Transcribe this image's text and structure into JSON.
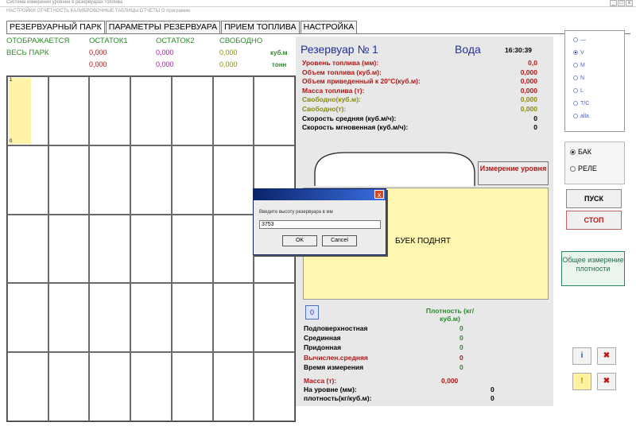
{
  "window": {
    "title": "Система измерения уровней в резервуарах топлива",
    "min_btn": "_",
    "max_btn": "□",
    "close_btn": "x"
  },
  "menu": {
    "items": "НАСТРОЙКИ   ОТЧЕТНОСТЬ   КАЛИБРОВОЧНЫЕ ТАБЛИЦЫ   ОТЧЕТЫ   О программе"
  },
  "tabs": [
    {
      "label": "РЕЗЕРВУАРНЫЙ ПАРК",
      "active": true
    },
    {
      "label": "ПАРАМЕТРЫ РЕЗЕРВУАРА",
      "active": false
    },
    {
      "label": "ПРИЕМ ТОПЛИВА",
      "active": false
    },
    {
      "label": "НАСТРОЙКА",
      "active": false
    }
  ],
  "summary": {
    "header_displayed": "ОТОБРАЖАЕТСЯ",
    "header_all_park": "ВЕСЬ ПАРК",
    "header_rest1": "ОСТАТОК1",
    "header_rest2": "ОСТАТОК2",
    "header_free": "СВОБОДНО",
    "rest1_m3": "0,000",
    "rest2_m3": "0,000",
    "free_m3": "0,000",
    "unit_m3": "куб.м",
    "rest1_t": "0,000",
    "rest2_t": "0,000",
    "free_t": "0,000",
    "unit_t": "тонн"
  },
  "grid": {
    "cols": 7,
    "rows": 5,
    "first_cell_top": "1",
    "first_cell_bottom": "0"
  },
  "tank": {
    "title": "Резервуар №",
    "number": "1",
    "product": "Вода",
    "time": "16:30:39",
    "params": [
      {
        "label": "Уровень топлива (мм):",
        "value": "0,0",
        "color": "#b01818"
      },
      {
        "label": "Объем топлива (куб.м):",
        "value": "0,000",
        "color": "#b01818"
      },
      {
        "label": "Объем приведенный к 20°С(куб.м):",
        "value": "0,000",
        "color": "#b01818"
      },
      {
        "label": "Масса топлива (т):",
        "value": "0,000",
        "color": "#b01818"
      },
      {
        "label": "Свободно(куб.м):",
        "value": "0,000",
        "color": "#8a8a10"
      },
      {
        "label": "Свободно(т):",
        "value": "0,000",
        "color": "#8a8a10"
      },
      {
        "label": "Скорость средняя (куб.м/ч):",
        "value": "0",
        "color": "#000000"
      },
      {
        "label": "Скорость мгновенная (куб.м/ч):",
        "value": "0",
        "color": "#000000"
      }
    ],
    "measure_button": "Измерение уровня",
    "float_status": "БУЕК ПОДНЯТ",
    "small_btn": "0",
    "density_header": "Плотность (кг/куб.м)",
    "density_rows": [
      {
        "label": "Подповерхностная",
        "value": "0",
        "color": "#000000"
      },
      {
        "label": "Срединная",
        "value": "0",
        "color": "#000000"
      },
      {
        "label": "Придонная",
        "value": "0",
        "color": "#000000"
      },
      {
        "label": "Вычислен.средняя",
        "value": "0",
        "color": "#b01818"
      },
      {
        "label": "Время измерения",
        "value": "0",
        "color": "#000000"
      }
    ],
    "mass_label": "Масса (т):",
    "mass_value": "0,000",
    "level_label": "На уровне (мм):",
    "level_value": "0",
    "density_label": "плотность(кг/куб.м):",
    "density_value": "0"
  },
  "right_panel": {
    "radio_options": [
      "—",
      "V",
      "M",
      "N",
      "L",
      "T/C",
      "alla"
    ],
    "radio_selected_index": 1,
    "mode_options": [
      "БАК",
      "РЕЛЕ"
    ],
    "mode_selected_index": 0,
    "start_button": "ПУСК",
    "stop_button": "СТОП",
    "density_button": "Общее измерение плотности",
    "icon_info": "i",
    "icon_x1": "✖",
    "icon_warn": "!",
    "icon_x2": "✖"
  },
  "dialog": {
    "close": "x",
    "prompt": "Введите высоту резервуара в мм",
    "value": "3753",
    "ok": "OK",
    "cancel": "Cancel"
  }
}
